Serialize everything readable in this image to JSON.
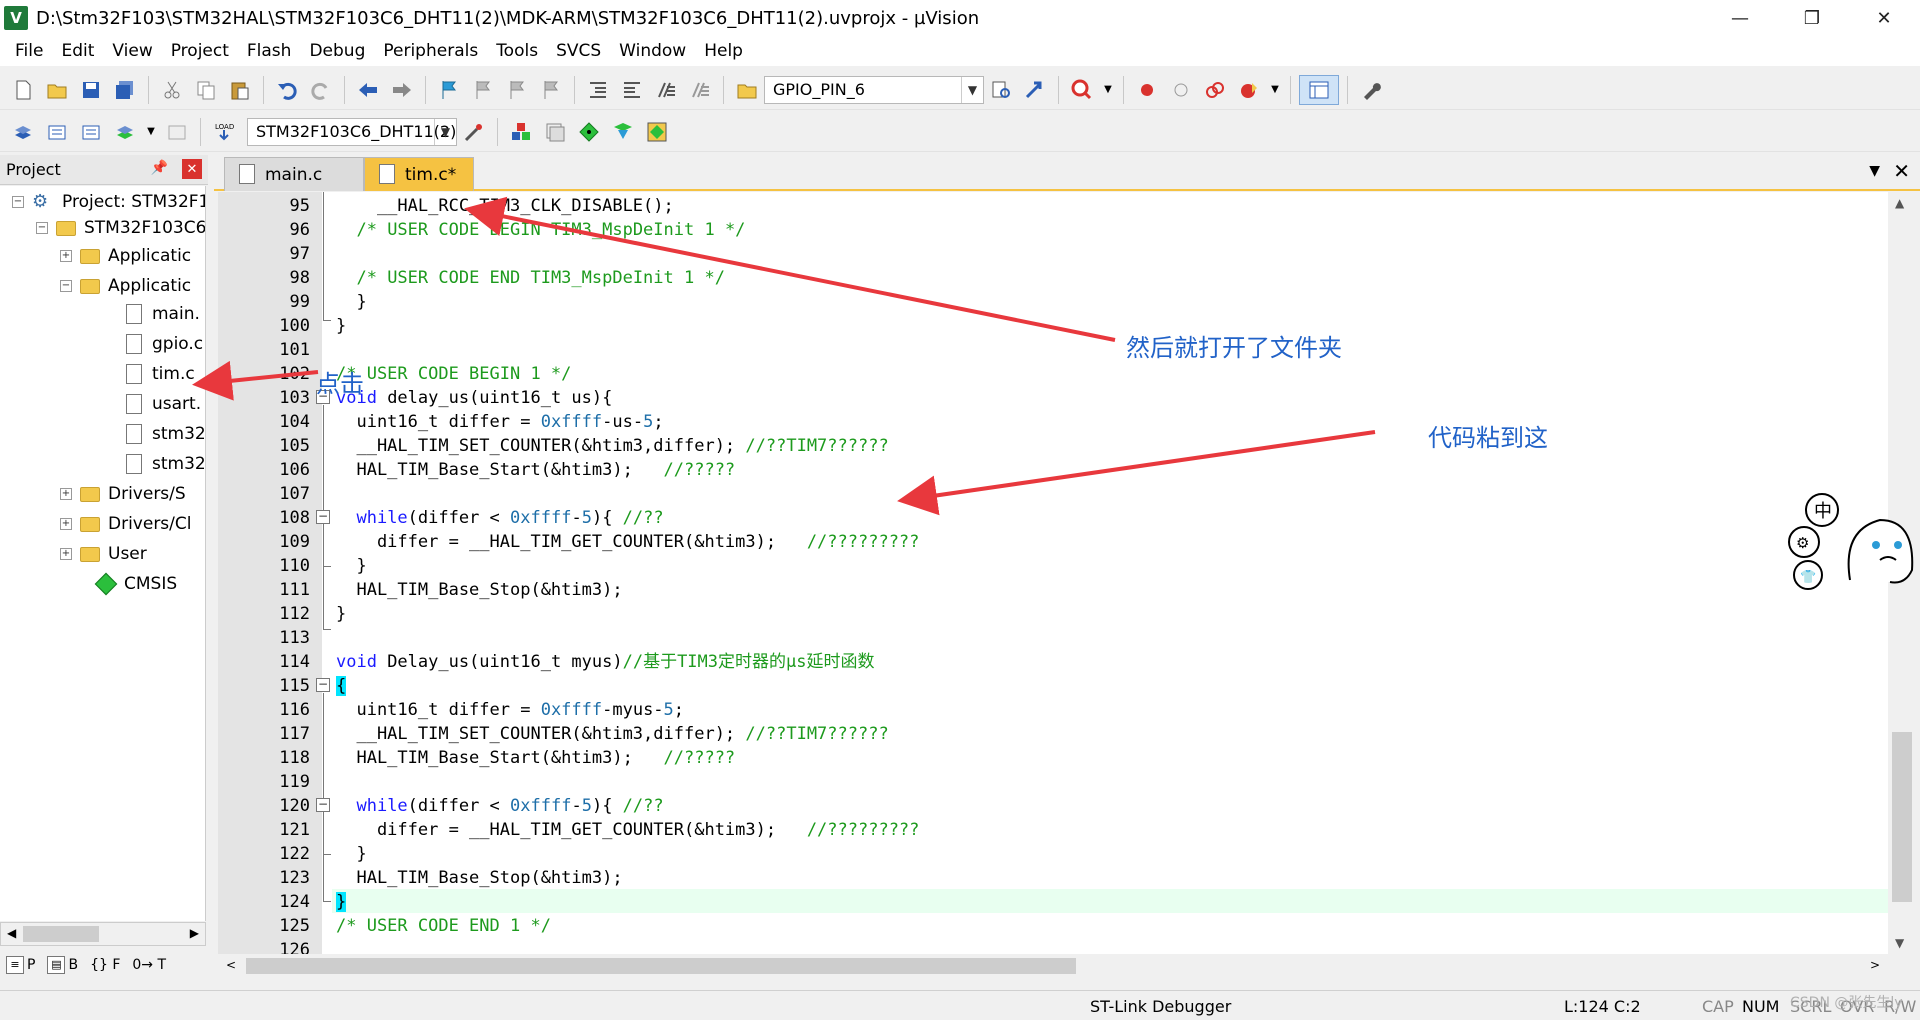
{
  "window": {
    "title": "D:\\Stm32F103\\STM32HAL\\STM32F103C6_DHT11(2)\\MDK-ARM\\STM32F103C6_DHT11(2).uvprojx - µVision",
    "app_icon_letter": "V",
    "minimize": "—",
    "maximize": "❐",
    "close": "✕"
  },
  "menu": [
    "File",
    "Edit",
    "View",
    "Project",
    "Flash",
    "Debug",
    "Peripherals",
    "Tools",
    "SVCS",
    "Window",
    "Help"
  ],
  "toolbar": {
    "find_combo_value": "GPIO_PIN_6",
    "target_combo_value": "STM32F103C6_DHT11(2)",
    "load_label": "LOAD"
  },
  "project_panel": {
    "title": "Project",
    "items": [
      {
        "label": "Project: STM32F1(",
        "type": "project",
        "expander": "⊟"
      },
      {
        "label": "STM32F103C6",
        "type": "target",
        "expander": "⊟"
      },
      {
        "label": "Applicatic",
        "type": "folder",
        "expander": "⊞"
      },
      {
        "label": "Applicatic",
        "type": "folder",
        "expander": "⊟"
      },
      {
        "label": "main.",
        "type": "file"
      },
      {
        "label": "gpio.c",
        "type": "file"
      },
      {
        "label": "tim.c",
        "type": "file"
      },
      {
        "label": "usart.",
        "type": "file"
      },
      {
        "label": "stm32",
        "type": "file"
      },
      {
        "label": "stm32",
        "type": "file"
      },
      {
        "label": "Drivers/S",
        "type": "folder",
        "expander": "⊞"
      },
      {
        "label": "Drivers/Cl",
        "type": "folder",
        "expander": "⊞"
      },
      {
        "label": "User",
        "type": "folder",
        "expander": "⊞"
      },
      {
        "label": "CMSIS",
        "type": "component"
      }
    ],
    "bottom_tabs": [
      "P",
      "B",
      "{} F",
      "0→ T"
    ]
  },
  "editor": {
    "tabs": [
      {
        "label": "main.c",
        "active": false
      },
      {
        "label": "tim.c*",
        "active": true
      }
    ],
    "lines": [
      {
        "n": "95",
        "t": "    __HAL_RCC_TIM3_CLK_DISABLE();"
      },
      {
        "n": "96",
        "t": "  /* USER CODE BEGIN TIM3_MspDeInit 1 */"
      },
      {
        "n": "97",
        "t": ""
      },
      {
        "n": "98",
        "t": "  /* USER CODE END TIM3_MspDeInit 1 */"
      },
      {
        "n": "99",
        "t": "  }"
      },
      {
        "n": "100",
        "t": "}"
      },
      {
        "n": "101",
        "t": ""
      },
      {
        "n": "102",
        "t": "/* USER CODE BEGIN 1 */"
      },
      {
        "n": "103",
        "t": "void delay_us(uint16_t us){"
      },
      {
        "n": "104",
        "t": "  uint16_t differ = 0xffff-us-5;"
      },
      {
        "n": "105",
        "t": "  __HAL_TIM_SET_COUNTER(&htim3,differ); //??TIM7??????"
      },
      {
        "n": "106",
        "t": "  HAL_TIM_Base_Start(&htim3);   //?????"
      },
      {
        "n": "107",
        "t": ""
      },
      {
        "n": "108",
        "t": "  while(differ < 0xffff-5){ //??"
      },
      {
        "n": "109",
        "t": "    differ = __HAL_TIM_GET_COUNTER(&htim3);   //?????????"
      },
      {
        "n": "110",
        "t": "  }"
      },
      {
        "n": "111",
        "t": "  HAL_TIM_Base_Stop(&htim3);"
      },
      {
        "n": "112",
        "t": "}"
      },
      {
        "n": "113",
        "t": ""
      },
      {
        "n": "114",
        "t": "void Delay_us(uint16_t myus)//基于TIM3定时器的μs延时函数"
      },
      {
        "n": "115",
        "t": "{"
      },
      {
        "n": "116",
        "t": "  uint16_t differ = 0xffff-myus-5;"
      },
      {
        "n": "117",
        "t": "  __HAL_TIM_SET_COUNTER(&htim3,differ); //??TIM7??????"
      },
      {
        "n": "118",
        "t": "  HAL_TIM_Base_Start(&htim3);   //?????"
      },
      {
        "n": "119",
        "t": ""
      },
      {
        "n": "120",
        "t": "  while(differ < 0xffff-5){ //??"
      },
      {
        "n": "121",
        "t": "    differ = __HAL_TIM_GET_COUNTER(&htim3);   //?????????"
      },
      {
        "n": "122",
        "t": "  }"
      },
      {
        "n": "123",
        "t": "  HAL_TIM_Base_Stop(&htim3);"
      },
      {
        "n": "124",
        "t": "}"
      },
      {
        "n": "125",
        "t": "/* USER CODE END 1 */"
      },
      {
        "n": "126",
        "t": ""
      }
    ]
  },
  "annotations": {
    "opened_folder": "然后就打开了文件夹",
    "click": "点击",
    "paste_here": "代码粘到这",
    "color": "#e8383d"
  },
  "sticker": {
    "chars": [
      "中",
      "⚙",
      "👕"
    ]
  },
  "status": {
    "debugger": "ST-Link Debugger",
    "position": "L:124 C:2",
    "cap": "CAP",
    "num": "NUM",
    "scrl": "SCRL",
    "ovr": "OVR",
    "rw": "R/W",
    "watermark": "CSDN @张先生ly"
  }
}
